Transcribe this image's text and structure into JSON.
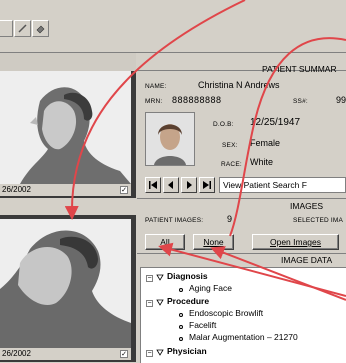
{
  "patient_summary": {
    "title": "PATIENT SUMMAR",
    "name_label": "NAME:",
    "name_value": "Christina N Andrews",
    "mrn_label": "MRN:",
    "mrn_value": "888888888",
    "ssn_label": "SS#:",
    "ssn_value": "99",
    "dob_label": "D.O.B:",
    "dob_value": "12/25/1947",
    "sex_label": "SEX:",
    "sex_value": "Female",
    "race_label": "RACE:",
    "race_value": "White"
  },
  "nav": {
    "view_search_label": "View Patient Search F"
  },
  "images": {
    "title": "IMAGES",
    "patient_images_label": "PATIENT IMAGES:",
    "patient_images_count": "9",
    "selected_label": "SELECTED IMA",
    "all_label": "All",
    "none_label": "None",
    "open_label": "Open Images",
    "image_data_title": "IMAGE DATA"
  },
  "thumbnails": [
    {
      "date": "26/2002"
    },
    {
      "date": "26/2002"
    }
  ],
  "tree": {
    "items": [
      {
        "label": "Diagnosis",
        "bold": true
      },
      {
        "label": "Aging Face",
        "bold": false
      },
      {
        "label": "Procedure",
        "bold": true
      },
      {
        "label": "Endoscopic Browlift",
        "bold": false
      },
      {
        "label": "Facelift",
        "bold": false
      },
      {
        "label": "Malar Augmentation – 21270",
        "bold": false
      },
      {
        "label": "Physician",
        "bold": true
      }
    ]
  },
  "colors": {
    "arrow": "#e0464a",
    "panel_bg": "#d4d0c8",
    "thumb_border": "#3a3a3a"
  }
}
